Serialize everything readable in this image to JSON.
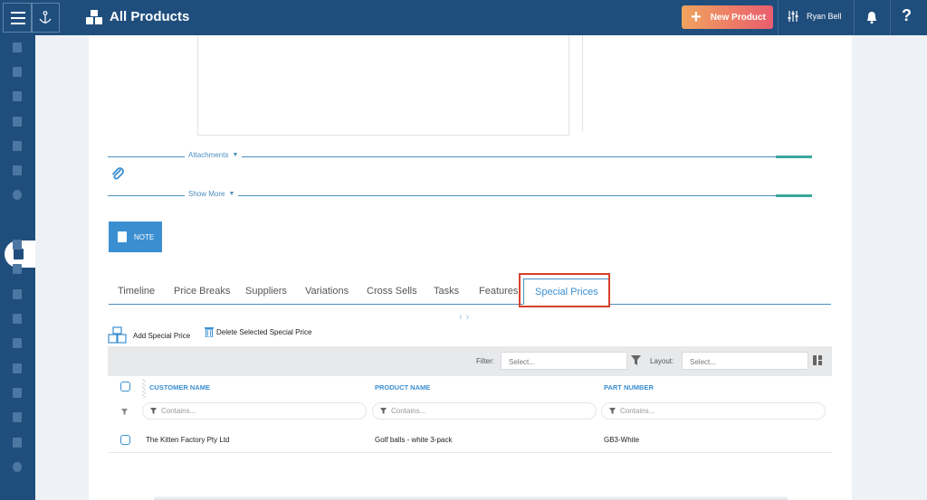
{
  "header": {
    "title": "All Products",
    "new_product_label": "New Product",
    "user_name": "Ryan Bell",
    "help_label": "?"
  },
  "sections": {
    "attachments_label": "Attachments",
    "show_more_label": "Show More",
    "note_button_label": "NOTE"
  },
  "tabs": [
    {
      "label": "Timeline"
    },
    {
      "label": "Price Breaks"
    },
    {
      "label": "Suppliers"
    },
    {
      "label": "Variations"
    },
    {
      "label": "Cross Sells"
    },
    {
      "label": "Tasks"
    },
    {
      "label": "Features"
    },
    {
      "label": "Special Prices",
      "active": true
    }
  ],
  "actions": {
    "add_label": "Add Special Price",
    "delete_label": "Delete Selected Special Price"
  },
  "toolbar": {
    "filter_label": "Filter:",
    "filter_placeholder": "Select...",
    "layout_label": "Layout:",
    "layout_placeholder": "Select..."
  },
  "grid": {
    "columns": [
      "CUSTOMER NAME",
      "PRODUCT NAME",
      "PART NUMBER"
    ],
    "filter_placeholder": "Contains...",
    "rows": [
      {
        "customer": "The Kitten Factory Pty Ltd",
        "product": "Golf balls - white 3-pack",
        "part": "GB3-White"
      }
    ]
  },
  "colors": {
    "navy": "#1f4e7d",
    "accent_blue": "#3b8fd1",
    "teal": "#3aa89b",
    "highlight_red": "#d9402b",
    "new_button_gradient": [
      "#f0a35e",
      "#ea5d6e"
    ]
  },
  "icons": {
    "menu": "hamburger-icon",
    "app": "anchor-icon",
    "products": "boxes-icon",
    "settings": "sliders-icon",
    "notifications": "bell-icon",
    "attachment": "paperclip-icon",
    "note": "note-icon",
    "add": "boxes-add-icon",
    "delete": "trash-icon",
    "filter": "funnel-icon",
    "layout": "layout-icon"
  }
}
